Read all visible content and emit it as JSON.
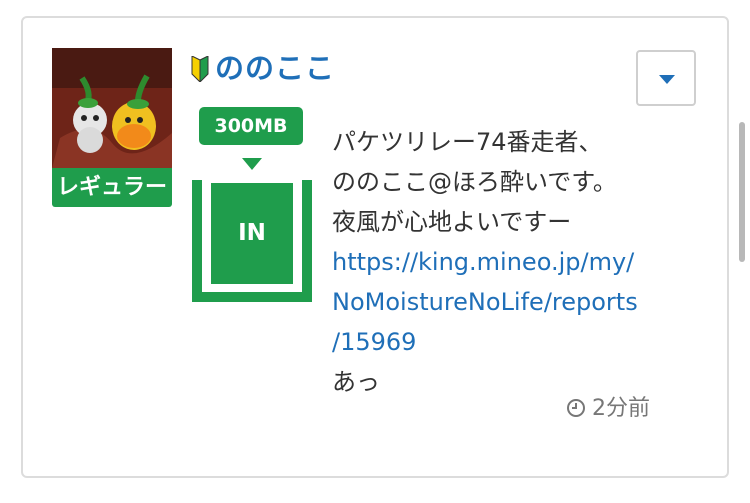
{
  "post": {
    "username": "ののここ",
    "rank_label": "レギュラー",
    "data_amount": "300MB",
    "direction_label": "IN",
    "message_lines": [
      "パケツリレー74番走者、",
      "ののここ@ほろ酔いです。",
      "夜風が心地よいですー"
    ],
    "link_lines": [
      "https://king.mineo.jp/my/",
      "NoMoistureNoLife/reports",
      "/15969"
    ],
    "closing_line": "あっ",
    "timestamp": "2分前"
  },
  "colors": {
    "accent_green": "#1f9d4c",
    "link_blue": "#1f6fb8"
  },
  "icons": {
    "beginner": "beginner-mark-icon",
    "menu": "caret-down-icon",
    "clock": "clock-icon"
  }
}
